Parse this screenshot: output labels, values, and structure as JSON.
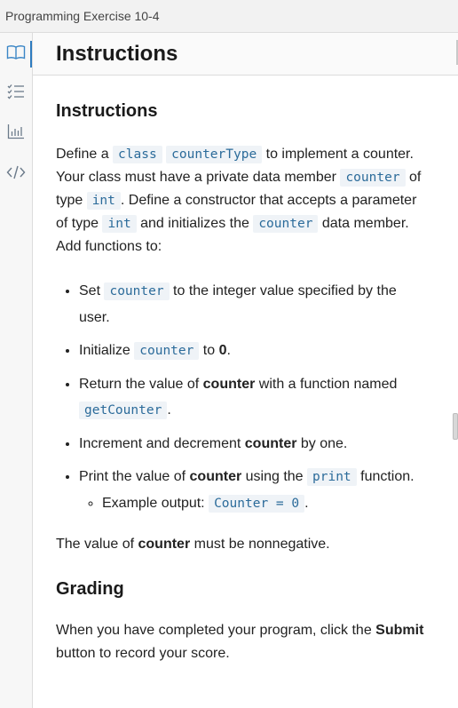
{
  "window": {
    "title": "Programming Exercise 10-4"
  },
  "sidebar": {
    "items": [
      {
        "name": "instructions",
        "icon": "book-icon",
        "active": true
      },
      {
        "name": "tasks",
        "icon": "checklist-icon",
        "active": false
      },
      {
        "name": "results",
        "icon": "bar-chart-icon",
        "active": false
      },
      {
        "name": "code",
        "icon": "code-icon",
        "active": false
      }
    ]
  },
  "header": {
    "title": "Instructions"
  },
  "content": {
    "heading": "Instructions",
    "intro": {
      "t1": "Define a ",
      "c1": "class",
      "c2": "counterType",
      "t2": " to implement a counter. Your class must have a private data member ",
      "c3": "counter",
      "t3": " of type ",
      "c4": "int",
      "t4": ". Define a constructor that accepts a parameter of type ",
      "c5": "int",
      "t5": " and initializes the ",
      "c6": "counter",
      "t6": " data member. Add functions to:"
    },
    "bullets": [
      {
        "t1": "Set ",
        "code": "counter",
        "t2": " to the integer value specified by the user."
      },
      {
        "t1": "Initialize ",
        "code": "counter",
        "t2": " to ",
        "bold": "0",
        "t3": "."
      },
      {
        "t1": "Return the value of ",
        "bold": "counter",
        "t2": " with a function named ",
        "code": "getCounter",
        "t3": "."
      },
      {
        "t1": "Increment and decrement ",
        "bold": "counter",
        "t2": " by one."
      },
      {
        "t1": "Print the value of ",
        "bold": "counter",
        "t2": " using the ",
        "code": "print",
        "t3": " function.",
        "sub": {
          "t1": "Example output: ",
          "code": "Counter = 0",
          "t2": "."
        }
      }
    ],
    "nonneg": {
      "t1": "The value of ",
      "bold": "counter",
      "t2": " must be nonnegative."
    },
    "grading": {
      "heading": "Grading",
      "t1": "When you have completed your program, click the ",
      "bold": "Submit",
      "t2": " button to record your score."
    }
  }
}
